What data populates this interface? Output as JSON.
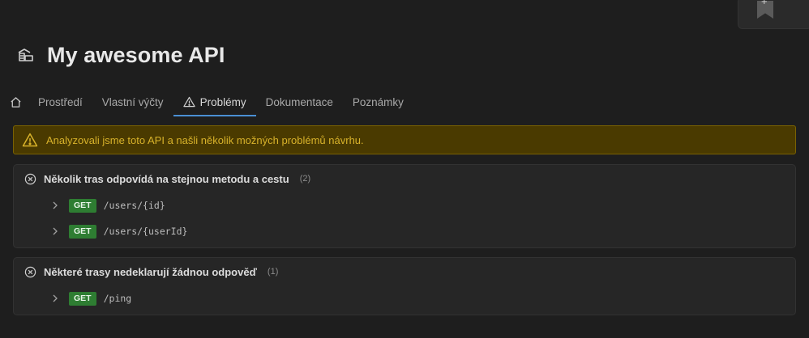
{
  "header": {
    "title": "My awesome API"
  },
  "tabs": [
    {
      "label": "Prostředí"
    },
    {
      "label": "Vlastní výčty"
    },
    {
      "label": "Problémy"
    },
    {
      "label": "Dokumentace"
    },
    {
      "label": "Poznámky"
    }
  ],
  "banner": {
    "text": "Analyzovali jsme toto API a našli několik možných problémů návrhu."
  },
  "problems": [
    {
      "title": "Několik tras odpovídá na stejnou metodu a cestu",
      "count": "(2)",
      "routes": [
        {
          "method": "GET",
          "path": "/users/{id}"
        },
        {
          "method": "GET",
          "path": "/users/{userId}"
        }
      ]
    },
    {
      "title": "Některé trasy nedeklarují žádnou odpověď",
      "count": "(1)",
      "routes": [
        {
          "method": "GET",
          "path": "/ping"
        }
      ]
    }
  ],
  "corner": {
    "plus": "+"
  },
  "colors": {
    "accent": "#4a8fd4",
    "warning_text": "#d8b22a",
    "warning_bg": "#4a3a00",
    "get_method": "#2e7d32"
  },
  "icons": {
    "api": "api-icon",
    "home": "home-icon",
    "warning": "warning-icon",
    "error": "circle-x-icon",
    "chevron": "chevron-right-icon",
    "bookmark": "bookmark-add-icon"
  }
}
